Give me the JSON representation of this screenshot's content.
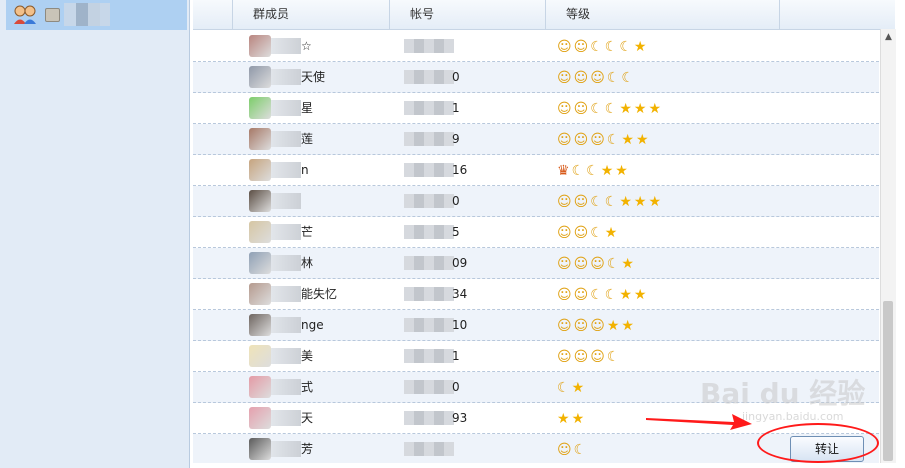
{
  "left_panel": {
    "group_icon": "group-icon",
    "badge_icon": "qq-group-badge-icon"
  },
  "table": {
    "headers": [
      "群成员",
      "帐号",
      "等级"
    ],
    "rows": [
      {
        "name": "☆",
        "account": "",
        "level": [
          "smile",
          "smile",
          "moon",
          "moon",
          "moon",
          "star"
        ],
        "avatar": "#b9857f"
      },
      {
        "name": "天使",
        "account": "0",
        "level": [
          "smile",
          "smile",
          "smile",
          "moon",
          "moon"
        ],
        "avatar": "#8f98a8"
      },
      {
        "name": "星",
        "account": "1",
        "level": [
          "smile",
          "smile",
          "moon",
          "moon",
          "star",
          "star",
          "star"
        ],
        "avatar": "#7ccd6a"
      },
      {
        "name": "莲",
        "account": "9",
        "level": [
          "smile",
          "smile",
          "smile",
          "moon",
          "star",
          "star"
        ],
        "avatar": "#a67866"
      },
      {
        "name": "n",
        "account": "16",
        "level": [
          "crown",
          "moon",
          "moon",
          "star",
          "star"
        ],
        "avatar": "#c6a47e"
      },
      {
        "name": "",
        "account": "0",
        "level": [
          "smile",
          "smile",
          "moon",
          "moon",
          "star",
          "star",
          "star"
        ],
        "avatar": "#5b4e44"
      },
      {
        "name": "芒",
        "account": "5",
        "level": [
          "smile",
          "smile",
          "moon",
          "star"
        ],
        "avatar": "#d6c6a3"
      },
      {
        "name": "林",
        "account": "09",
        "level": [
          "smile",
          "smile",
          "smile",
          "moon",
          "star"
        ],
        "avatar": "#8fa0b5"
      },
      {
        "name": "能失忆",
        "account": "34",
        "level": [
          "smile",
          "smile",
          "moon",
          "moon",
          "star",
          "star"
        ],
        "avatar": "#b59a8e"
      },
      {
        "name": "nge",
        "account": "10",
        "level": [
          "smile",
          "smile",
          "smile",
          "star",
          "star"
        ],
        "avatar": "#6e6560"
      },
      {
        "name": "美",
        "account": "1",
        "level": [
          "smile",
          "smile",
          "smile",
          "moon"
        ],
        "avatar": "#efe3b8"
      },
      {
        "name": "式",
        "account": "0",
        "level": [
          "moon",
          "star"
        ],
        "avatar": "#e49aa5"
      },
      {
        "name": "天",
        "account": "93",
        "level": [
          "star",
          "star"
        ],
        "avatar": "#e5a0ad"
      },
      {
        "name": "芳",
        "account": "",
        "level": [
          "smile",
          "moon"
        ],
        "avatar": "#5a5a5a"
      }
    ]
  },
  "glyphs": {
    "smile": "☺",
    "moon": "☾",
    "star": "★",
    "crown": "♛"
  },
  "actions": {
    "transfer_label": "转让"
  },
  "watermark": {
    "brand": "Bai du 经验",
    "url": "jingyan.baidu.com"
  },
  "colors": {
    "accent_selected": "#aed0f2",
    "left_bg": "#e2ebf6",
    "annotation_red": "#ff1a1a"
  }
}
